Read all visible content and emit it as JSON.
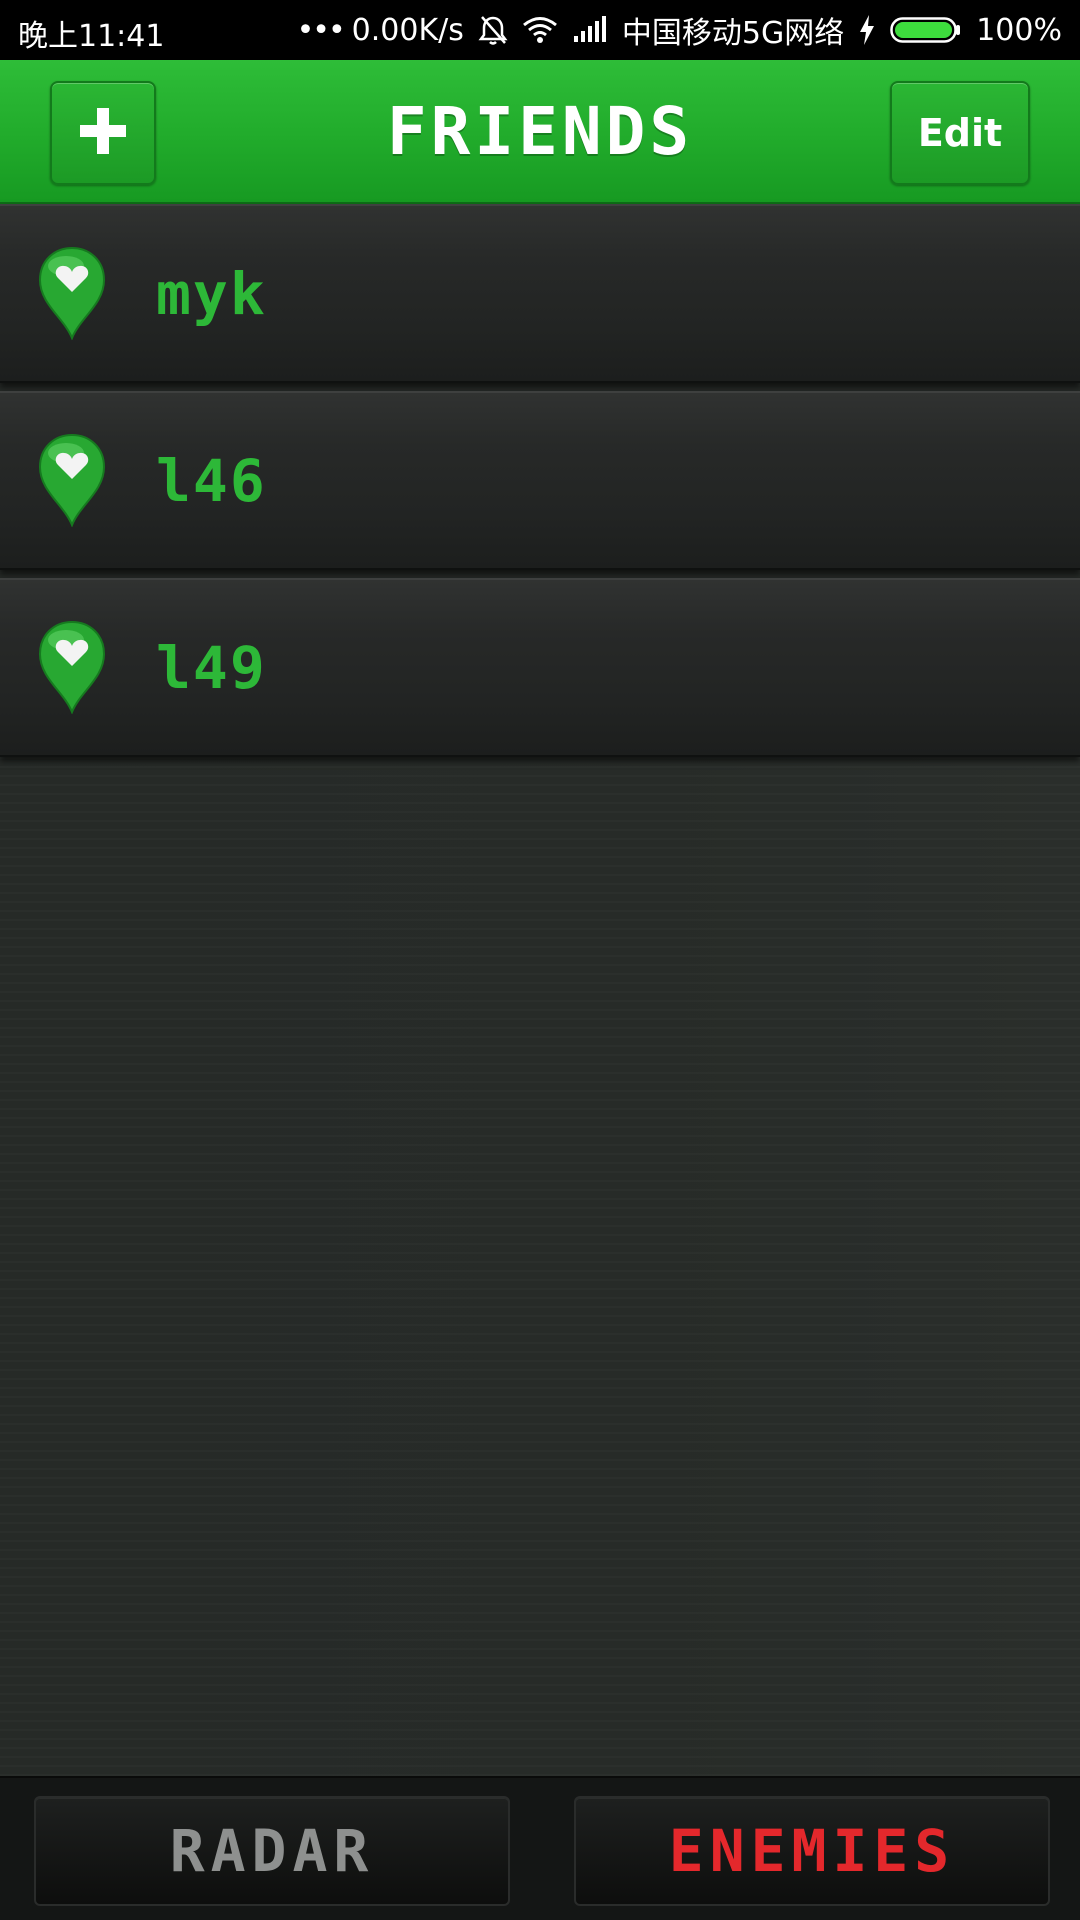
{
  "status_bar": {
    "time": "晚上11:41",
    "dots": "•••",
    "net_speed": "0.00K/s",
    "carrier": "中国移动5G网络",
    "battery": "100%",
    "icons": [
      "bell-muted-icon",
      "wifi-icon",
      "signal-icon",
      "charging-bolt-icon",
      "battery-icon"
    ]
  },
  "header": {
    "title": "FRIENDS",
    "add_label": "+",
    "edit_label": "Edit",
    "color": "#24b02f"
  },
  "friends": [
    {
      "name": "myk",
      "icon": "heart-pin-icon"
    },
    {
      "name": "l46",
      "icon": "heart-pin-icon"
    },
    {
      "name": "l49",
      "icon": "heart-pin-icon"
    }
  ],
  "bottom_tabs": [
    {
      "label": "RADAR",
      "color": "#8e908f"
    },
    {
      "label": "ENEMIES",
      "color": "#e4282c"
    }
  ]
}
